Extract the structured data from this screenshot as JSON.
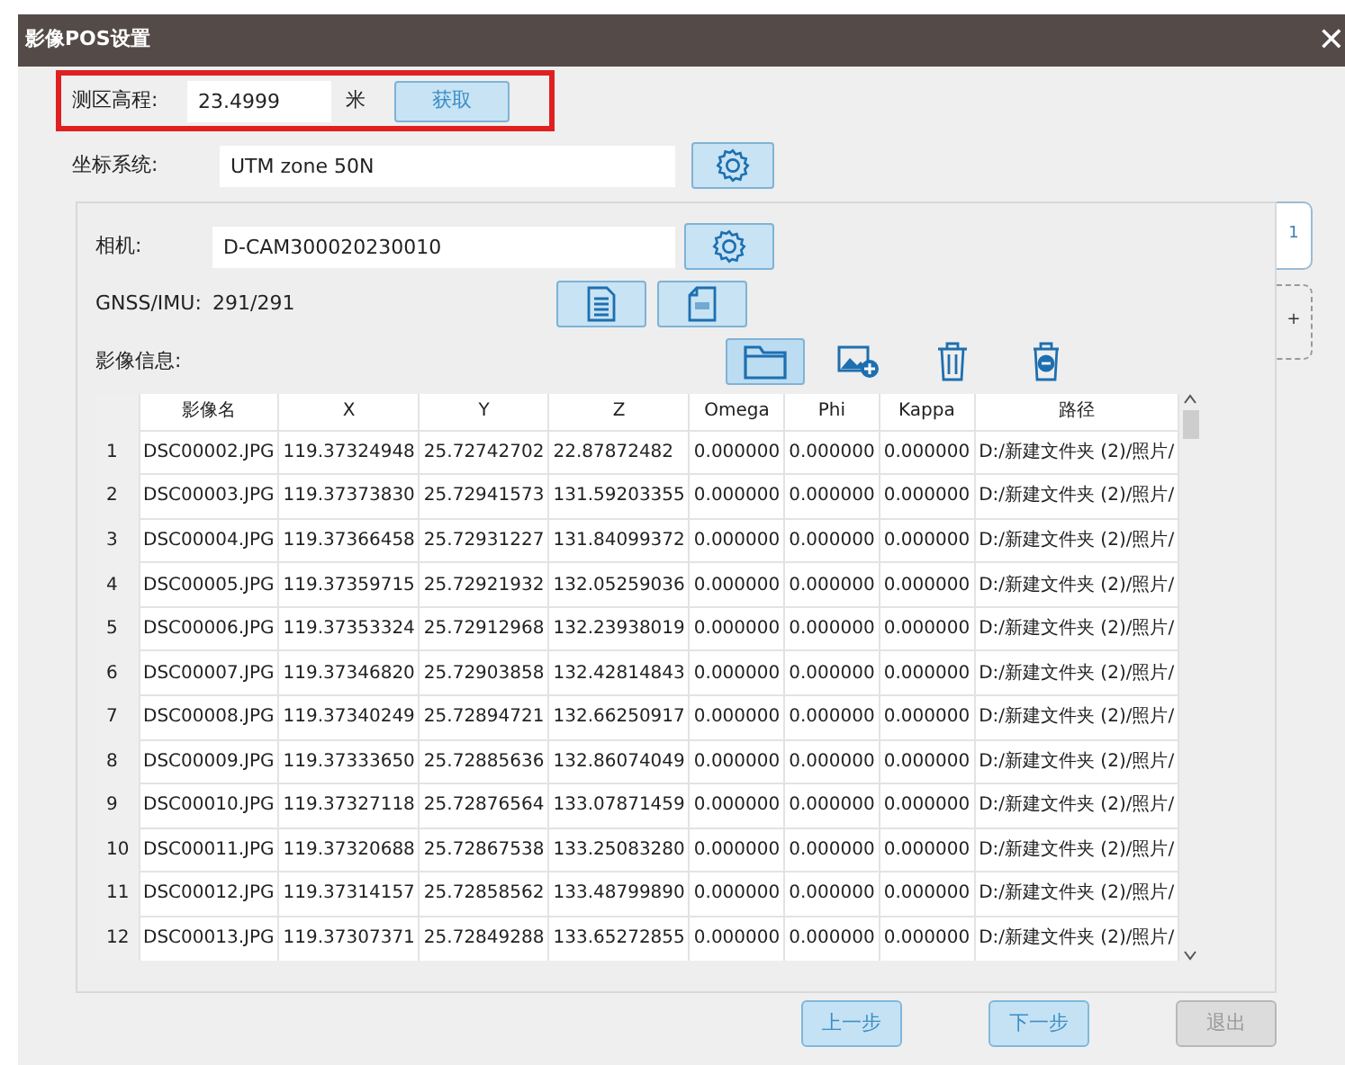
{
  "window": {
    "title": "影像POS设置",
    "close": "✕"
  },
  "elevation": {
    "label": "测区高程:",
    "value": "23.4999",
    "unit": "米",
    "button": "获取",
    "highlighted": true
  },
  "coordinate_system": {
    "label": "坐标系统:",
    "value": "UTM zone 50N"
  },
  "camera": {
    "label": "相机:",
    "value": "D-CAM300020230010"
  },
  "gnss": {
    "label": "GNSS/IMU:",
    "value": "291/291"
  },
  "image_info": {
    "label": "影像信息:"
  },
  "toolbar": [
    {
      "kind": "folder",
      "selected": true
    },
    {
      "kind": "image-add",
      "selected": false
    },
    {
      "kind": "trash",
      "selected": false
    },
    {
      "kind": "trash-minus",
      "selected": false
    }
  ],
  "side_tabs": [
    {
      "label": "1",
      "selected": true
    },
    {
      "label": "+",
      "selected": false
    }
  ],
  "table": {
    "columns": [
      "影像名",
      "X",
      "Y",
      "Z",
      "Omega",
      "Phi",
      "Kappa",
      "路径"
    ],
    "rows": [
      {
        "index": "1",
        "cells": [
          "DSC00002.JPG",
          "119.37324948",
          "25.72742702",
          "22.87872482",
          "0.000000",
          "0.000000",
          "0.000000",
          "D:/新建文件夹 (2)/照片/"
        ]
      },
      {
        "index": "2",
        "cells": [
          "DSC00003.JPG",
          "119.37373830",
          "25.72941573",
          "131.59203355",
          "0.000000",
          "0.000000",
          "0.000000",
          "D:/新建文件夹 (2)/照片/"
        ]
      },
      {
        "index": "3",
        "cells": [
          "DSC00004.JPG",
          "119.37366458",
          "25.72931227",
          "131.84099372",
          "0.000000",
          "0.000000",
          "0.000000",
          "D:/新建文件夹 (2)/照片/"
        ]
      },
      {
        "index": "4",
        "cells": [
          "DSC00005.JPG",
          "119.37359715",
          "25.72921932",
          "132.05259036",
          "0.000000",
          "0.000000",
          "0.000000",
          "D:/新建文件夹 (2)/照片/"
        ]
      },
      {
        "index": "5",
        "cells": [
          "DSC00006.JPG",
          "119.37353324",
          "25.72912968",
          "132.23938019",
          "0.000000",
          "0.000000",
          "0.000000",
          "D:/新建文件夹 (2)/照片/"
        ]
      },
      {
        "index": "6",
        "cells": [
          "DSC00007.JPG",
          "119.37346820",
          "25.72903858",
          "132.42814843",
          "0.000000",
          "0.000000",
          "0.000000",
          "D:/新建文件夹 (2)/照片/"
        ]
      },
      {
        "index": "7",
        "cells": [
          "DSC00008.JPG",
          "119.37340249",
          "25.72894721",
          "132.66250917",
          "0.000000",
          "0.000000",
          "0.000000",
          "D:/新建文件夹 (2)/照片/"
        ]
      },
      {
        "index": "8",
        "cells": [
          "DSC00009.JPG",
          "119.37333650",
          "25.72885636",
          "132.86074049",
          "0.000000",
          "0.000000",
          "0.000000",
          "D:/新建文件夹 (2)/照片/"
        ]
      },
      {
        "index": "9",
        "cells": [
          "DSC00010.JPG",
          "119.37327118",
          "25.72876564",
          "133.07871459",
          "0.000000",
          "0.000000",
          "0.000000",
          "D:/新建文件夹 (2)/照片/"
        ]
      },
      {
        "index": "10",
        "cells": [
          "DSC00011.JPG",
          "119.37320688",
          "25.72867538",
          "133.25083280",
          "0.000000",
          "0.000000",
          "0.000000",
          "D:/新建文件夹 (2)/照片/"
        ]
      },
      {
        "index": "11",
        "cells": [
          "DSC00012.JPG",
          "119.37314157",
          "25.72858562",
          "133.48799890",
          "0.000000",
          "0.000000",
          "0.000000",
          "D:/新建文件夹 (2)/照片/"
        ]
      },
      {
        "index": "12",
        "cells": [
          "DSC00013.JPG",
          "119.37307371",
          "25.72849288",
          "133.65272855",
          "0.000000",
          "0.000000",
          "0.000000",
          "D:/新建文件夹 (2)/照片/"
        ]
      }
    ]
  },
  "footer_buttons": [
    {
      "label": "上一步",
      "disabled": false
    },
    {
      "label": "下一步",
      "disabled": false
    },
    {
      "label": "退出",
      "disabled": true
    }
  ]
}
